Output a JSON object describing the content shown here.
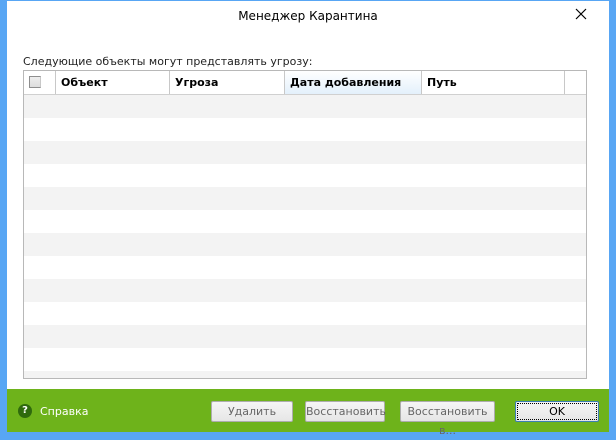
{
  "window": {
    "title": "Менеджер Карантина"
  },
  "label": "Следующие объекты могут представлять угрозу:",
  "table": {
    "columns": [
      "Объект",
      "Угроза",
      "Дата добавления",
      "Путь"
    ],
    "rows": []
  },
  "footer": {
    "help": "Справка",
    "delete": "Удалить",
    "restore": "Восстановить",
    "restore_to": "Восстановить в...",
    "ok": "OK"
  },
  "colors": {
    "footer": "#6eb31b",
    "border": "#58a6f4"
  }
}
